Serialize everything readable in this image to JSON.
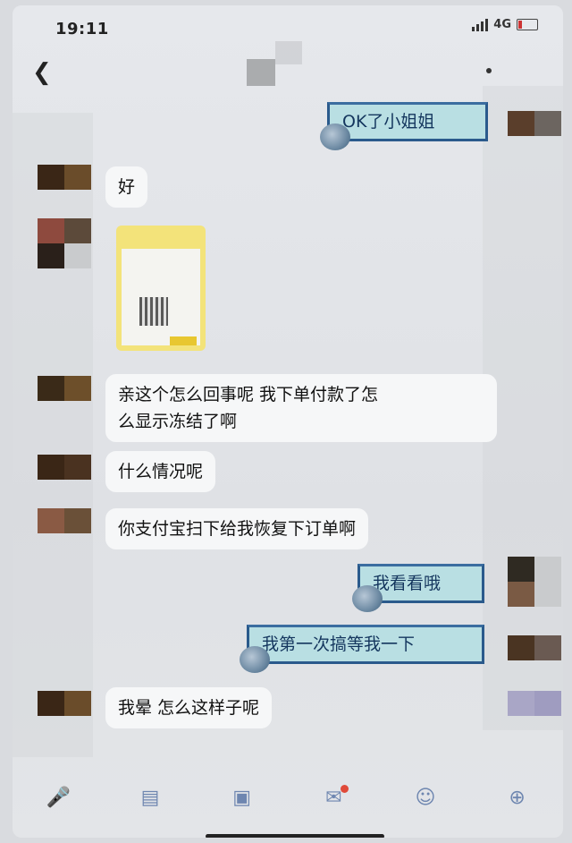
{
  "status": {
    "time": "19:11",
    "network": "4G"
  },
  "messages": {
    "m1": "OK了小姐姐",
    "m2": "好",
    "m3_line1": "亲这个怎么回事呢 我下单付款了怎",
    "m3_line2": "么显示冻结了啊",
    "m4": "什么情况呢",
    "m5": "你支付宝扫下给我恢复下订单啊",
    "m6": "我看看哦",
    "m7": "我第一次搞等我一下",
    "m8": "我晕 怎么这样子呢"
  },
  "icons": {
    "back": "chevron-left-icon",
    "mic": "microphone-icon",
    "image": "image-icon",
    "camera": "camera-icon",
    "redpacket": "red-packet-icon",
    "emoji": "emoji-icon",
    "plus": "plus-icon"
  },
  "colors": {
    "bubble_right_bg": "#b9dfe3",
    "bubble_right_border": "#2a5a8c",
    "bubble_left_bg": "#f6f7f8",
    "toolbar_icon": "#6e86b0"
  }
}
